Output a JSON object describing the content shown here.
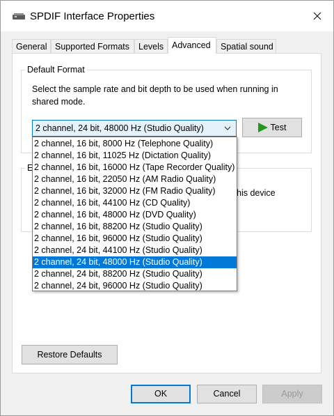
{
  "window": {
    "title": "SPDIF Interface Properties"
  },
  "tabs": [
    {
      "label": "General"
    },
    {
      "label": "Supported Formats"
    },
    {
      "label": "Levels"
    },
    {
      "label": "Advanced"
    },
    {
      "label": "Spatial sound"
    }
  ],
  "default_format": {
    "group_label": "Default Format",
    "description": "Select the sample rate and bit depth to be used when running in shared mode.",
    "selected": "2 channel, 24 bit, 48000 Hz (Studio Quality)",
    "test_label": "Test",
    "options": [
      "2 channel, 16 bit, 8000 Hz (Telephone Quality)",
      "2 channel, 16 bit, 11025 Hz (Dictation Quality)",
      "2 channel, 16 bit, 16000 Hz (Tape Recorder Quality)",
      "2 channel, 16 bit, 22050 Hz (AM Radio Quality)",
      "2 channel, 16 bit, 32000 Hz (FM Radio Quality)",
      "2 channel, 16 bit, 44100 Hz (CD Quality)",
      "2 channel, 16 bit, 48000 Hz (DVD Quality)",
      "2 channel, 16 bit, 88200 Hz (Studio Quality)",
      "2 channel, 16 bit, 96000 Hz (Studio Quality)",
      "2 channel, 24 bit, 44100 Hz (Studio Quality)",
      "2 channel, 24 bit, 48000 Hz (Studio Quality)",
      "2 channel, 24 bit, 88200 Hz (Studio Quality)",
      "2 channel, 24 bit, 96000 Hz (Studio Quality)"
    ],
    "selected_index": 10
  },
  "obscured_group": {
    "label_fragment": "E",
    "text_fragment": "his device"
  },
  "buttons": {
    "restore_defaults": "Restore Defaults",
    "ok": "OK",
    "cancel": "Cancel",
    "apply": "Apply"
  },
  "colors": {
    "accent": "#0078d7",
    "play_green": "#1e9b1e"
  }
}
